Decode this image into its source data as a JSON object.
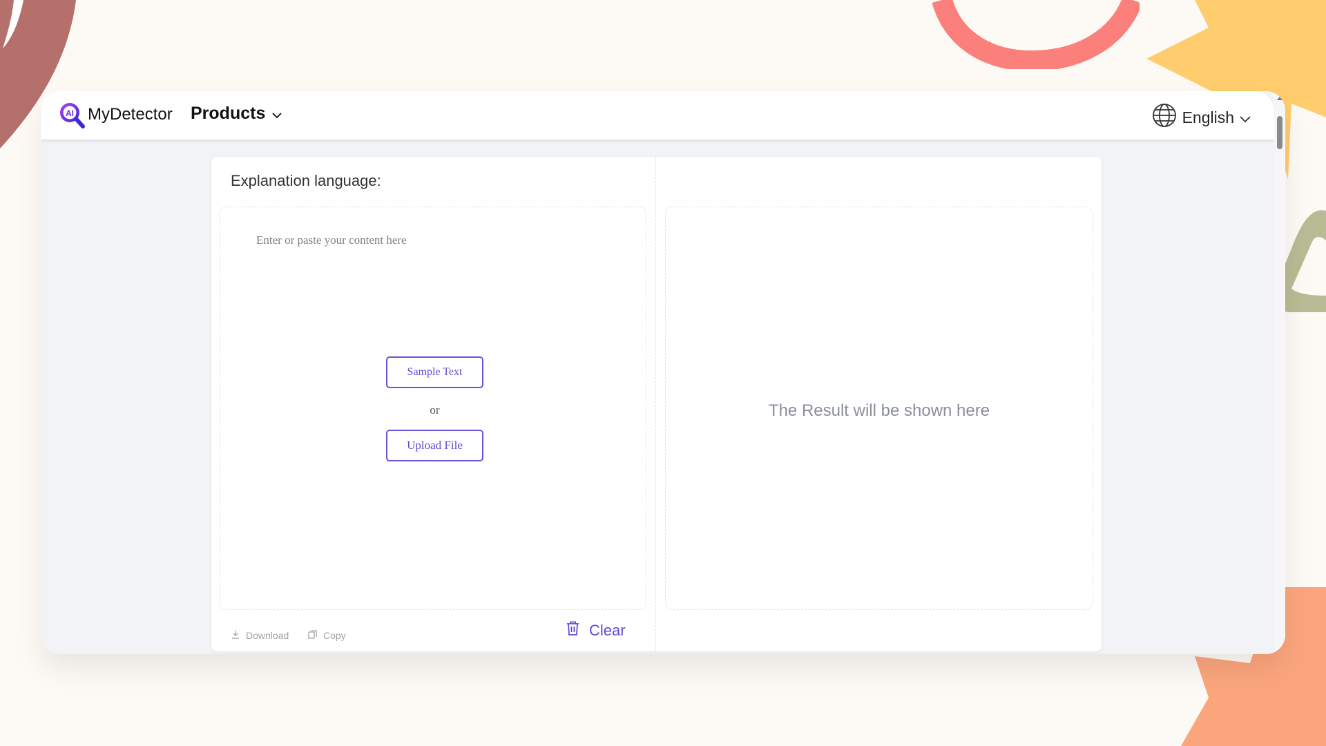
{
  "header": {
    "brand": "MyDetector",
    "logo_icon": "ai-magnifier-logo",
    "products_label": "Products",
    "language_label": "English"
  },
  "main": {
    "explanation_label": "Explanation language:",
    "input_placeholder": "Enter or paste your content here",
    "sample_button": "Sample Text",
    "or_text": "or",
    "upload_button": "Upload File",
    "result_placeholder": "The Result will be shown here"
  },
  "toolbar": {
    "download_label": "Download",
    "copy_label": "Copy",
    "clear_label": "Clear"
  },
  "colors": {
    "accent": "#5e4bd1",
    "page_background": "#fdfaf5",
    "window_background": "#f2f3f7"
  }
}
